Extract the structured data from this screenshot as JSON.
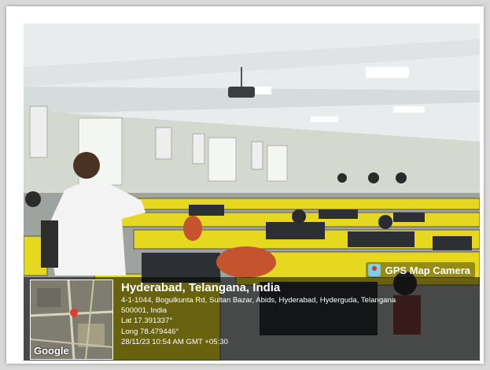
{
  "badge": {
    "label": "GPS Map Camera",
    "icon": "camera-pin-icon"
  },
  "location": {
    "title": "Hyderabad, Telangana, India",
    "address_line_1": "4-1-1044, Bogulkunta Rd, Sultan Bazar, Abids, Hyderabad, Hyderguda, Telangana",
    "address_line_2": "500001, India",
    "latitude": "Lat 17.391337°",
    "longitude": "Long 78.479446°",
    "timestamp": "28/11/23 10:54 AM GMT +05:30"
  },
  "map": {
    "provider_label": "Google",
    "marker_icon": "map-pin-icon"
  },
  "colors": {
    "desk_yellow": "#e6d81e",
    "shirt_white": "#f3f3f3",
    "overlay": "#000000"
  }
}
